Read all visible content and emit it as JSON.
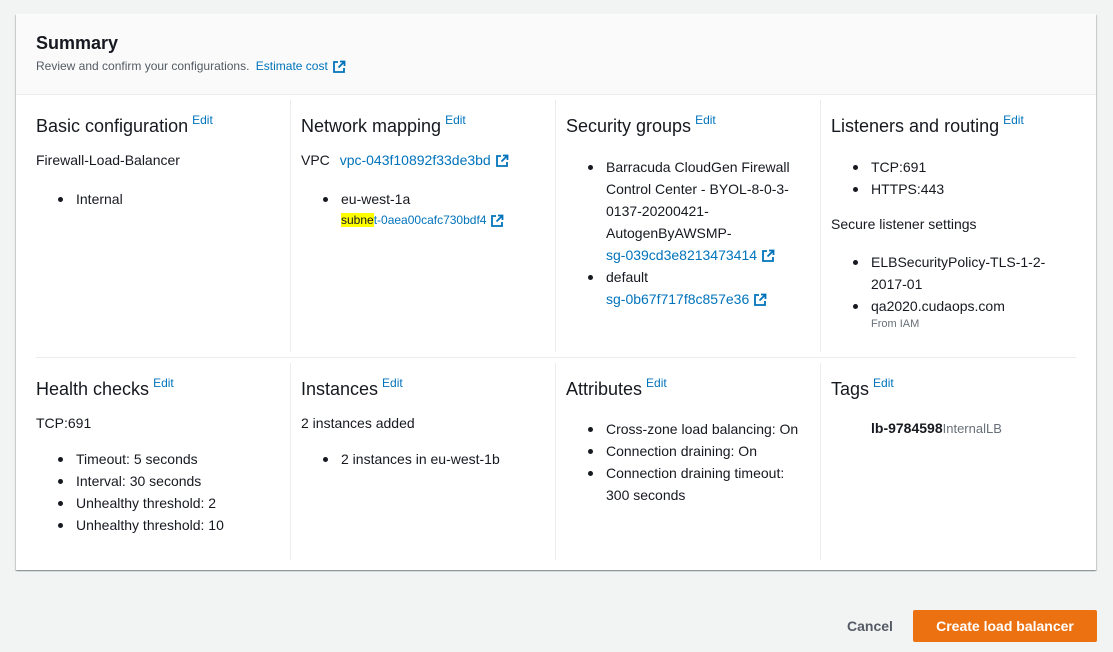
{
  "summary": {
    "title": "Summary",
    "description": "Review and confirm your configurations.",
    "estimate_link": "Estimate cost"
  },
  "edit_label": "Edit",
  "basic": {
    "title": "Basic configuration",
    "name": "Firewall-Load-Balancer",
    "scheme": "Internal"
  },
  "network": {
    "title": "Network mapping",
    "vpc_label": "VPC",
    "vpc_id": "vpc-043f10892f33de3bd",
    "az": "eu-west-1a",
    "subnet_highlight": "subne",
    "subnet_rest": "t-0aea00cafc730bdf4"
  },
  "security": {
    "title": "Security groups",
    "groups": [
      {
        "name_lines": [
          "Barracuda CloudGen Firewall",
          "Control Center - BYOL-8-0-3-",
          "0137-20200421-",
          "AutogenByAWSMP-"
        ],
        "id": "sg-039cd3e8213473414"
      },
      {
        "name_lines": [
          "default"
        ],
        "id": "sg-0b67f717f8c857e36"
      }
    ]
  },
  "listeners": {
    "title": "Listeners and routing",
    "items": [
      "TCP:691",
      "HTTPS:443"
    ],
    "secure_title": "Secure listener settings",
    "policy_lines": [
      "ELBSecurityPolicy-TLS-1-2-",
      "2017-01"
    ],
    "certificate": "qa2020.cudaops.com",
    "certificate_source": "From IAM"
  },
  "health": {
    "title": "Health checks",
    "target": "TCP:691",
    "items": [
      "Timeout: 5 seconds",
      "Interval: 30 seconds",
      "Unhealthy threshold: 2",
      "Unhealthy threshold: 10"
    ]
  },
  "instances": {
    "title": "Instances",
    "summary": "2 instances added",
    "items": [
      "2 instances in eu-west-1b"
    ]
  },
  "attributes": {
    "title": "Attributes",
    "items": [
      "Cross-zone load balancing: On",
      "Connection draining: On"
    ],
    "timeout_lines": [
      "Connection draining timeout:",
      "300 seconds"
    ]
  },
  "tags": {
    "title": "Tags",
    "key": "lb-9784598",
    "value": "InternalLB"
  },
  "actions": {
    "cancel": "Cancel",
    "create": "Create load balancer"
  },
  "colors": {
    "link": "#0073bb",
    "primary_button": "#ec7211",
    "highlight": "#ffff00"
  },
  "icons": {
    "external_link": "external-link-icon"
  }
}
